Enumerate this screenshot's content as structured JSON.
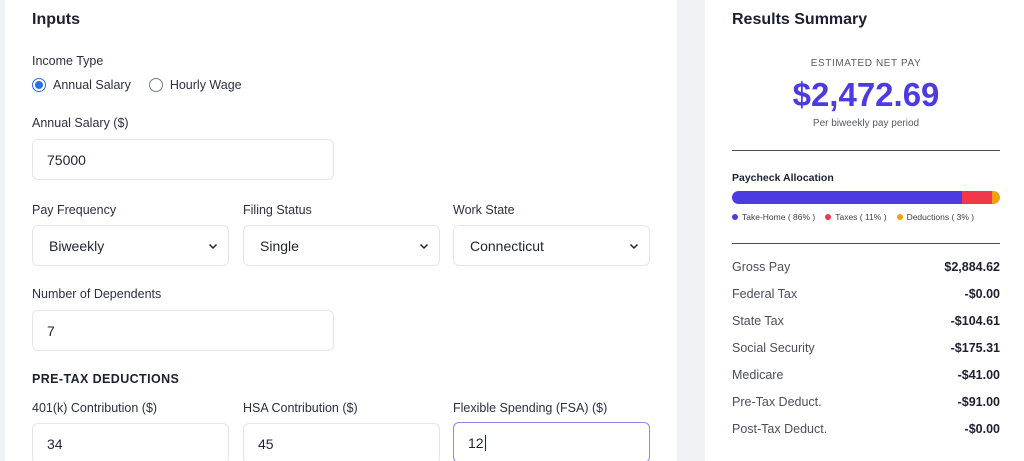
{
  "inputs": {
    "title": "Inputs",
    "income_type_label": "Income Type",
    "income_options": [
      {
        "label": "Annual Salary",
        "checked": true
      },
      {
        "label": "Hourly Wage",
        "checked": false
      }
    ],
    "annual_salary_label": "Annual Salary ($)",
    "annual_salary_value": "75000",
    "pay_frequency_label": "Pay Frequency",
    "pay_frequency_value": "Biweekly",
    "filing_status_label": "Filing Status",
    "filing_status_value": "Single",
    "work_state_label": "Work State",
    "work_state_value": "Connecticut",
    "dependents_label": "Number of Dependents",
    "dependents_value": "7",
    "pretax_heading": "PRE-TAX DEDUCTIONS",
    "k401_label": "401(k) Contribution ($)",
    "k401_value": "34",
    "hsa_label": "HSA Contribution ($)",
    "hsa_value": "45",
    "fsa_label": "Flexible Spending (FSA) ($)",
    "fsa_value": "12"
  },
  "results": {
    "title": "Results Summary",
    "net_caption": "ESTIMATED NET PAY",
    "net_value": "$2,472.69",
    "net_sub": "Per biweekly pay period",
    "allocation_title": "Paycheck Allocation",
    "allocation": [
      {
        "name": "Take-Home",
        "percent": 86,
        "label": "Take-Home ( 86% )",
        "color": "#4b3be0"
      },
      {
        "name": "Taxes",
        "percent": 11,
        "label": "Taxes ( 11% )",
        "color": "#f0384a"
      },
      {
        "name": "Deductions",
        "percent": 3,
        "label": "Deductions ( 3% )",
        "color": "#f59e0b"
      }
    ],
    "rows": [
      {
        "k": "Gross Pay",
        "v": "$2,884.62"
      },
      {
        "k": "Federal Tax",
        "v": "-$0.00"
      },
      {
        "k": "State Tax",
        "v": "-$104.61"
      },
      {
        "k": "Social Security",
        "v": "-$175.31"
      },
      {
        "k": "Medicare",
        "v": "-$41.00"
      },
      {
        "k": "Pre-Tax Deduct.",
        "v": "-$91.00"
      },
      {
        "k": "Post-Tax Deduct.",
        "v": "-$0.00"
      }
    ]
  },
  "colors": {
    "accent": "#4b3be0",
    "radio": "#2f6fe0",
    "focus": "#8f86e8"
  }
}
